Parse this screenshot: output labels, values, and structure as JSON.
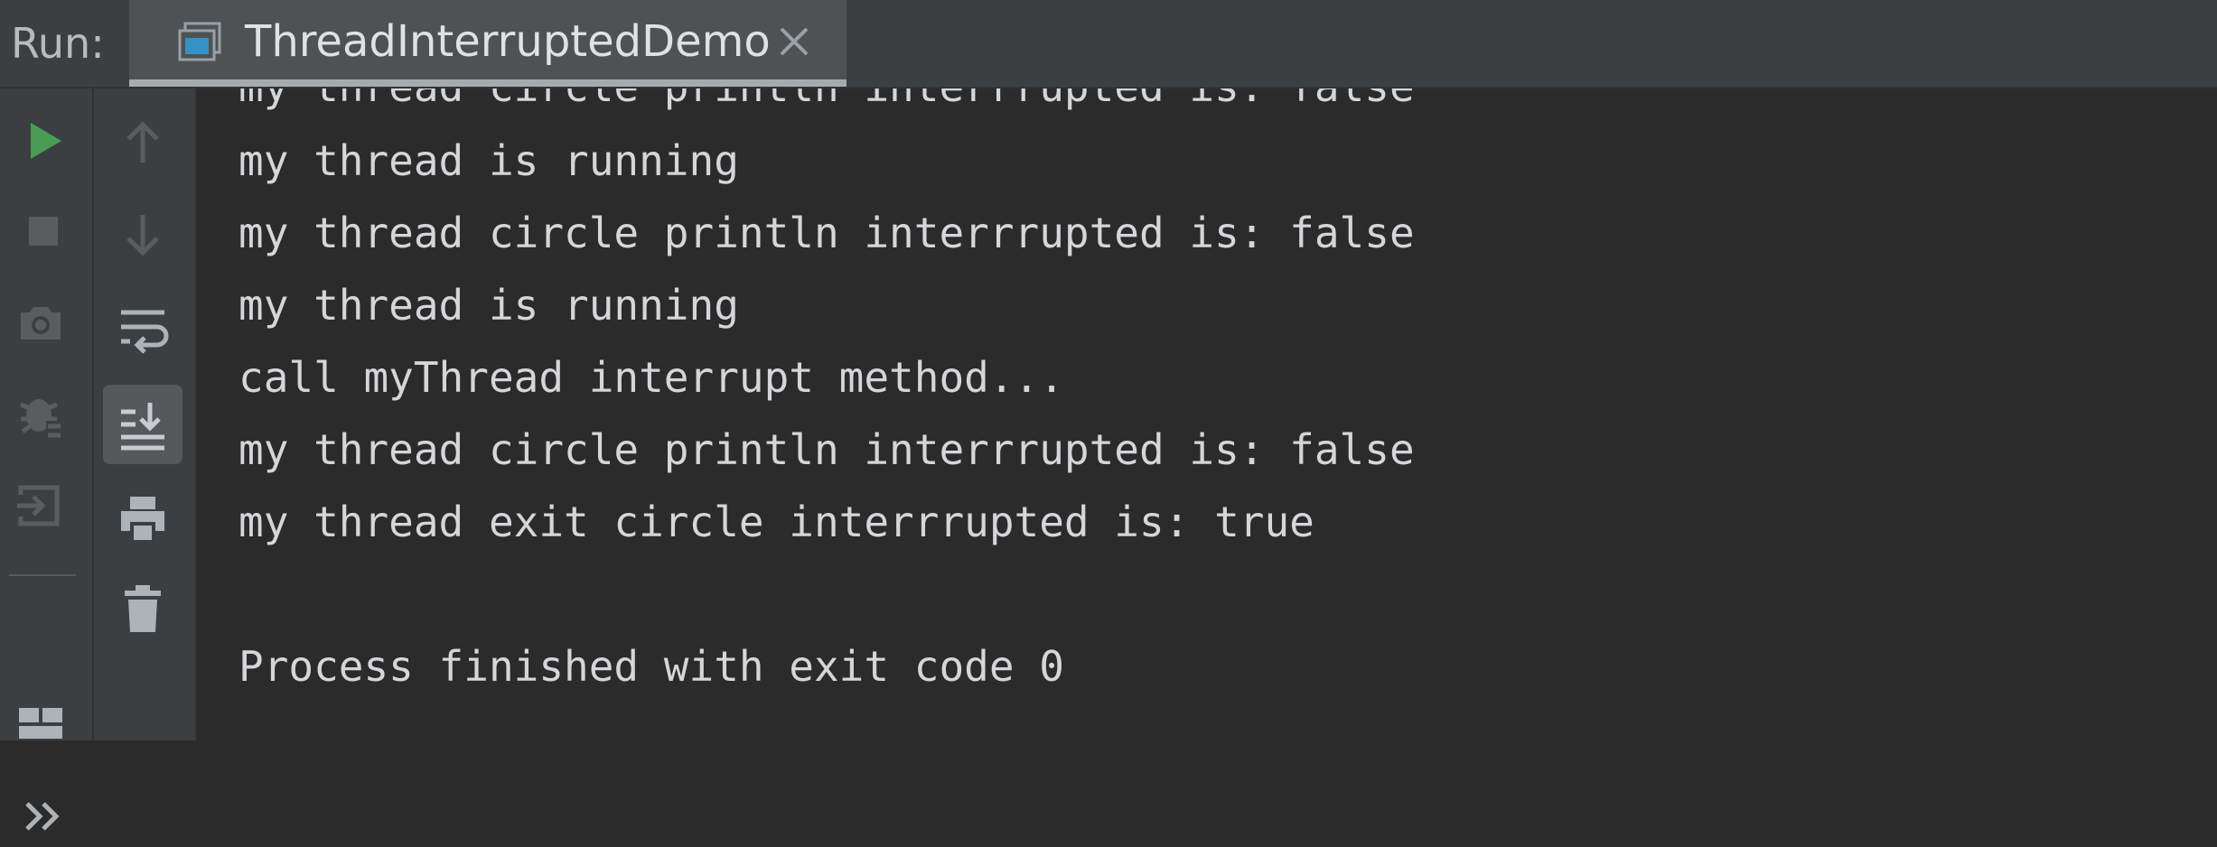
{
  "toolwindow": {
    "run_label": "Run:",
    "tab_title": "ThreadInterruptedDemo"
  },
  "gutter_left": [
    {
      "name": "rerun-icon"
    },
    {
      "name": "stop-icon"
    },
    {
      "name": "dump-threads-icon"
    },
    {
      "name": "exception-breakpoint-icon"
    },
    {
      "name": "restore-layout-icon"
    },
    {
      "name": "layout-icon"
    },
    {
      "name": "more-icon"
    }
  ],
  "gutter_right": [
    {
      "name": "up-arrow-icon"
    },
    {
      "name": "down-arrow-icon"
    },
    {
      "name": "soft-wrap-icon"
    },
    {
      "name": "scroll-to-end-icon",
      "active": true
    },
    {
      "name": "print-icon"
    },
    {
      "name": "trash-icon"
    }
  ],
  "console": {
    "lines": [
      "my thread circle println interrrupted is: false",
      "my thread is running",
      "my thread circle println interrrupted is: false",
      "my thread is running",
      "call myThread interrupt method...",
      "my thread circle println interrrupted is: false",
      "my thread exit circle interrrupted is: true",
      "",
      "Process finished with exit code 0"
    ]
  },
  "colors": {
    "run_green": "#499c54",
    "panel_bg": "#3c3f41",
    "console_bg": "#2b2b2b",
    "text": "#d4d6d9"
  }
}
